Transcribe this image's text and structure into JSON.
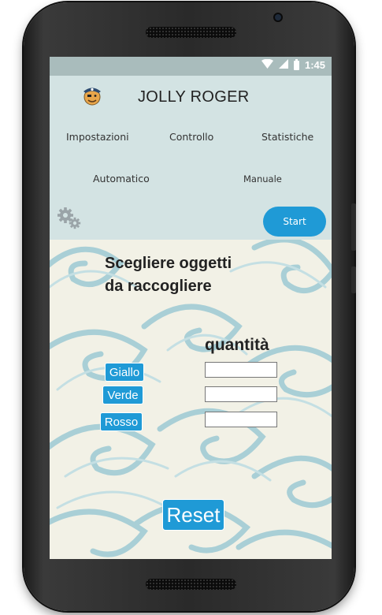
{
  "status": {
    "time": "1:45"
  },
  "app": {
    "title": "JOLLY ROGER"
  },
  "nav": {
    "impostazioni": "Impostazioni",
    "controllo": "Controllo",
    "statistiche": "Statistiche",
    "automatico": "Automatico",
    "manuale": "Manuale"
  },
  "actions": {
    "start": "Start",
    "reset": "Reset"
  },
  "form": {
    "headline_line1": "Scegliere oggetti",
    "headline_line2": "da raccogliere",
    "quantity_label": "quantità",
    "rows": [
      {
        "label": "Giallo",
        "value": ""
      },
      {
        "label": "Verde",
        "value": ""
      },
      {
        "label": "Rosso",
        "value": ""
      }
    ]
  },
  "colors": {
    "accent": "#1f9ad6",
    "header_bg": "#d3e3e3",
    "statusbar_bg": "#a9bcbc",
    "wave_bg": "#f2f1e6",
    "wave": "#a9cfd6"
  },
  "icons": {
    "logo": "pirate-avatar-icon",
    "settings": "gears-icon",
    "wifi": "wifi-icon",
    "signal": "signal-icon",
    "battery": "battery-icon"
  }
}
